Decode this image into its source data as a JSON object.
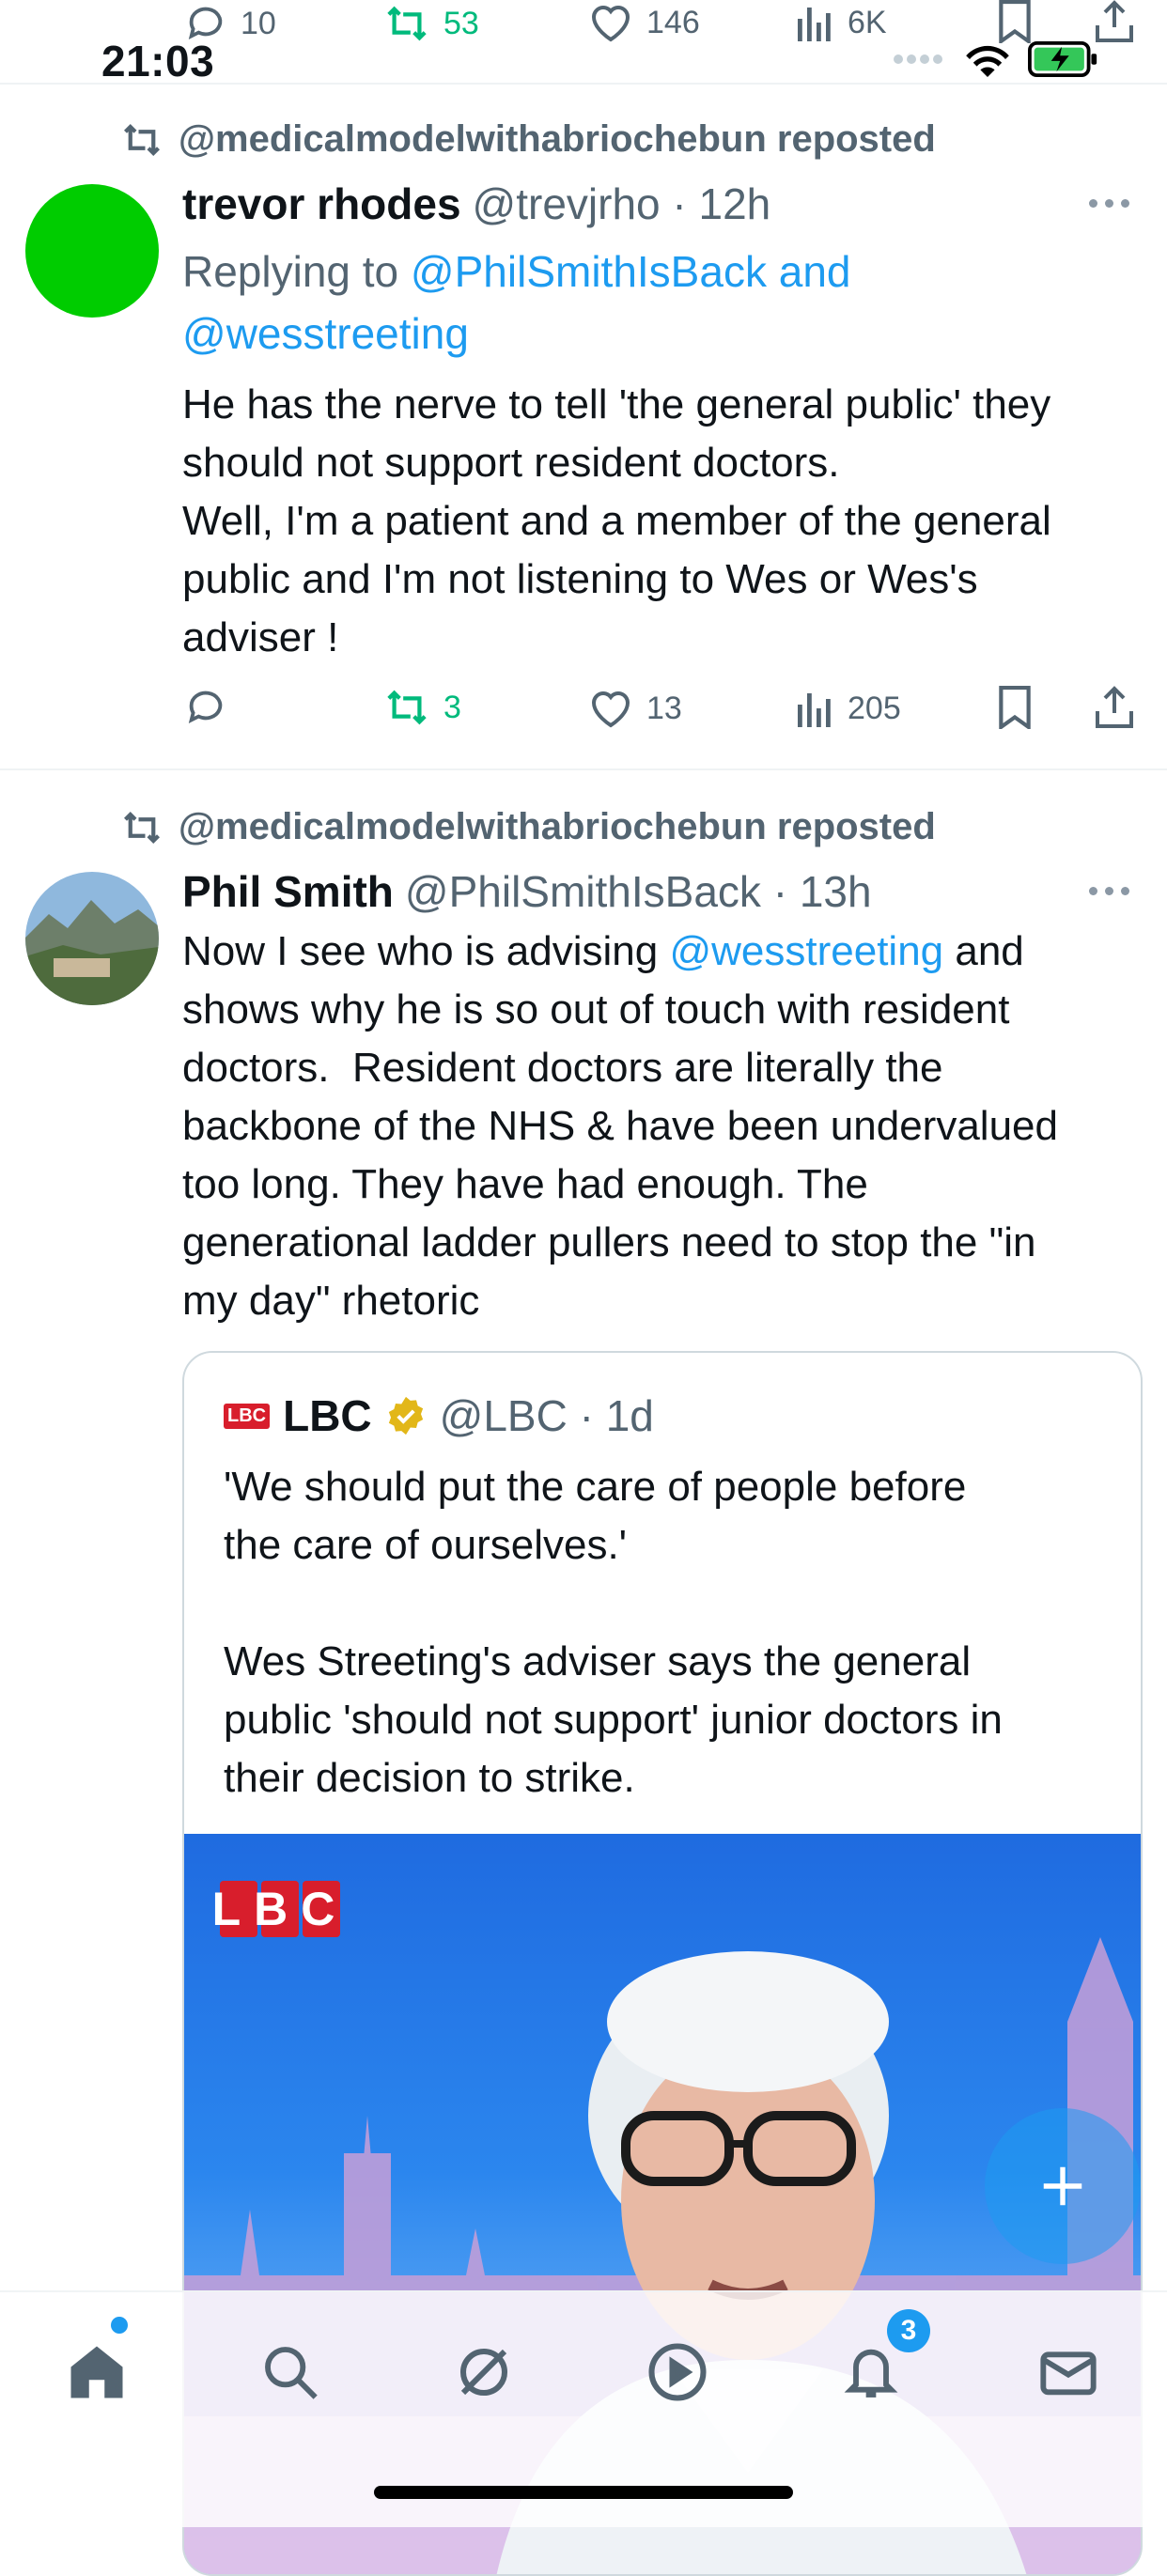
{
  "status_bar": {
    "time": "21:03",
    "signal_icon": "signal-dots-icon",
    "wifi_icon": "wifi-icon",
    "battery_icon": "battery-charging-icon"
  },
  "top_actions": {
    "reply_count": "10",
    "repost_count": "53",
    "like_count": "146",
    "view_count": "6K"
  },
  "tweet1": {
    "repost_label": "@medicalmodelwithabriochebun reposted",
    "name": "trevor rhodes",
    "handle_time": "@trevjrho · 12h",
    "replying_prefix": "Replying to ",
    "replying_to_line1": "@PhilSmithIsBack and",
    "replying_to_line2": "@wesstreeting",
    "text": "He has the nerve to tell 'the general public' they\nshould not support resident doctors.\nWell, I'm a patient and a member of the general\npublic and I'm not listening to Wes or Wes's\nadviser !",
    "reposts": "3",
    "likes": "13",
    "views": "205",
    "avatar_color": "#00cc00"
  },
  "tweet2": {
    "repost_label": "@medicalmodelwithabriochebun reposted",
    "name": "Phil Smith",
    "handle_time": "@PhilSmithIsBack · 13h",
    "text_before_mention": "Now I see who is advising ",
    "mention": "@wesstreeting",
    "text_after_mention": " and\nshows why he is so out of touch with resident\ndoctors.  Resident doctors are literally the\nbackbone of the NHS & have been undervalued\ntoo long. They have had enough. The\ngenerational ladder pullers need to stop the \"in\nmy day\" rhetoric"
  },
  "quote": {
    "logo_text": "LBC",
    "name": "LBC",
    "handle_time": "@LBC · 1d",
    "text": "'We should put the care of people before\nthe care of ourselves.'\n\nWes Streeting's adviser says the general\npublic 'should not support' junior doctors in\ntheir decision to strike.",
    "media_logo": "LBC"
  },
  "fab": {
    "icon": "plus-icon"
  },
  "bottom_nav": {
    "items": [
      "home-icon",
      "search-icon",
      "grok-icon",
      "play-icon",
      "bell-icon",
      "mail-icon"
    ],
    "notification_badge": "3"
  },
  "colors": {
    "accent": "#1d9bf0",
    "repost_green": "#00ba7c",
    "muted": "#536471"
  }
}
